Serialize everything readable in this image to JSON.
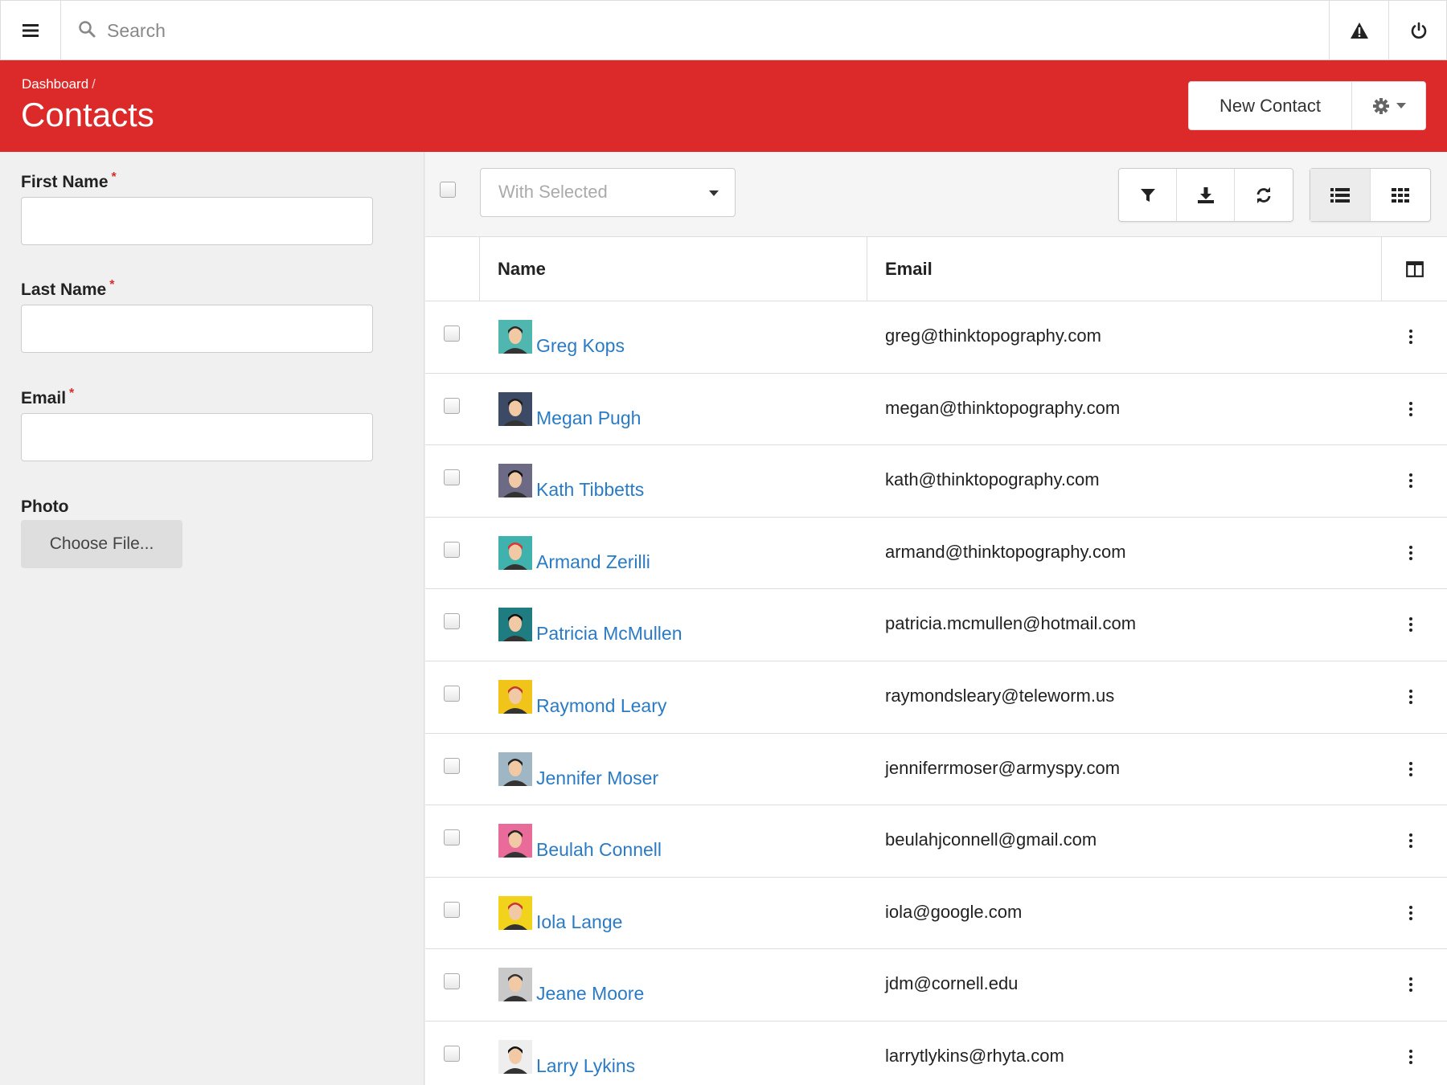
{
  "topbar": {
    "search_placeholder": "Search"
  },
  "header": {
    "breadcrumb": "Dashboard",
    "breadcrumb_sep": "/",
    "title": "Contacts",
    "new_contact_label": "New Contact"
  },
  "form": {
    "first_name_label": "First Name",
    "last_name_label": "Last Name",
    "email_label": "Email",
    "required_mark": "*",
    "photo_label": "Photo",
    "choose_file_label": "Choose File..."
  },
  "toolbar": {
    "with_selected_placeholder": "With Selected"
  },
  "table": {
    "columns": [
      "Name",
      "Email"
    ],
    "rows": [
      {
        "name": "Greg Kops",
        "email": "greg@thinktopography.com",
        "avatar_bg": "#4fb7b0"
      },
      {
        "name": "Megan Pugh",
        "email": "megan@thinktopography.com",
        "avatar_bg": "#3c4a66"
      },
      {
        "name": "Kath Tibbetts",
        "email": "kath@thinktopography.com",
        "avatar_bg": "#6d6a86"
      },
      {
        "name": "Armand Zerilli",
        "email": "armand@thinktopography.com",
        "avatar_bg": "#3fb2ad"
      },
      {
        "name": "Patricia McMullen",
        "email": "patricia.mcmullen@hotmail.com",
        "avatar_bg": "#1f7c80"
      },
      {
        "name": "Raymond Leary",
        "email": "raymondsleary@teleworm.us",
        "avatar_bg": "#f0c419"
      },
      {
        "name": "Jennifer Moser",
        "email": "jenniferrmoser@armyspy.com",
        "avatar_bg": "#9fb7c4"
      },
      {
        "name": "Beulah Connell",
        "email": "beulahjconnell@gmail.com",
        "avatar_bg": "#e96b9a"
      },
      {
        "name": "Iola Lange",
        "email": "iola@google.com",
        "avatar_bg": "#f2d31b"
      },
      {
        "name": "Jeane Moore",
        "email": "jdm@cornell.edu",
        "avatar_bg": "#c9c9c9"
      },
      {
        "name": "Larry Lykins",
        "email": "larrytlykins@rhyta.com",
        "avatar_bg": "#eeeeee"
      }
    ]
  },
  "colors": {
    "brand_red": "#dc2a2a",
    "link_blue": "#2b7bc4"
  }
}
